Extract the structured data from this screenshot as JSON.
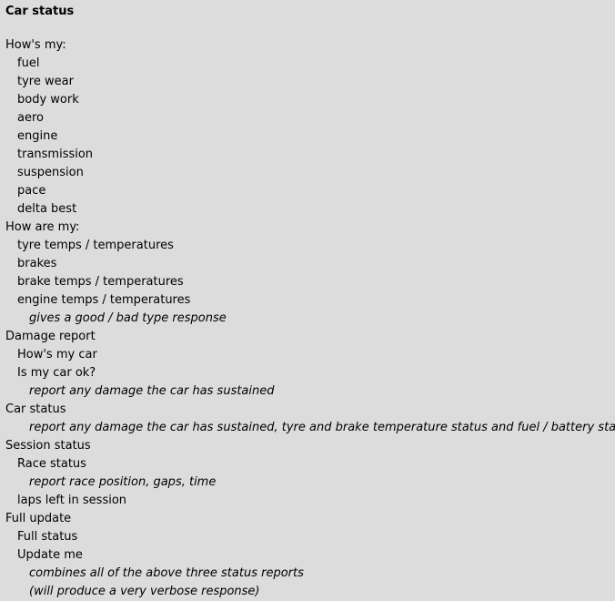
{
  "title": "Car status",
  "lines": [
    {
      "level": 0,
      "kind": "heading",
      "text": "How's my:"
    },
    {
      "level": 1,
      "kind": "phrase",
      "text": "fuel"
    },
    {
      "level": 1,
      "kind": "phrase",
      "text": "tyre wear"
    },
    {
      "level": 1,
      "kind": "phrase",
      "text": "body work"
    },
    {
      "level": 1,
      "kind": "phrase",
      "text": "aero"
    },
    {
      "level": 1,
      "kind": "phrase",
      "text": "engine"
    },
    {
      "level": 1,
      "kind": "phrase",
      "text": "transmission"
    },
    {
      "level": 1,
      "kind": "phrase",
      "text": "suspension"
    },
    {
      "level": 1,
      "kind": "phrase",
      "text": "pace"
    },
    {
      "level": 1,
      "kind": "phrase",
      "text": "delta best"
    },
    {
      "level": 0,
      "kind": "heading",
      "text": "How are my:"
    },
    {
      "level": 1,
      "kind": "phrase",
      "text": "tyre temps / temperatures"
    },
    {
      "level": 1,
      "kind": "phrase",
      "text": "brakes"
    },
    {
      "level": 1,
      "kind": "phrase",
      "text": "brake temps / temperatures"
    },
    {
      "level": 1,
      "kind": "phrase",
      "text": "engine temps / temperatures"
    },
    {
      "level": 2,
      "kind": "description",
      "text": "gives a good / bad type response"
    },
    {
      "level": 0,
      "kind": "heading",
      "text": "Damage report"
    },
    {
      "level": 1,
      "kind": "phrase",
      "text": "How's my car"
    },
    {
      "level": 1,
      "kind": "phrase",
      "text": "Is my car ok?"
    },
    {
      "level": 2,
      "kind": "description",
      "text": "report any damage the car has sustained"
    },
    {
      "level": 0,
      "kind": "heading",
      "text": "Car status"
    },
    {
      "level": 2,
      "kind": "description",
      "text": "report any damage the car has sustained, tyre and brake temperature status and fuel / battery status"
    },
    {
      "level": 0,
      "kind": "heading",
      "text": "Session status"
    },
    {
      "level": 1,
      "kind": "phrase",
      "text": "Race status"
    },
    {
      "level": 2,
      "kind": "description",
      "text": "report race position, gaps, time"
    },
    {
      "level": 1,
      "kind": "phrase",
      "text": "laps left in session"
    },
    {
      "level": 0,
      "kind": "heading",
      "text": "Full update"
    },
    {
      "level": 1,
      "kind": "phrase",
      "text": "Full status"
    },
    {
      "level": 1,
      "kind": "phrase",
      "text": "Update me"
    },
    {
      "level": 2,
      "kind": "description",
      "text": "combines all of the above three status reports"
    },
    {
      "level": 2,
      "kind": "description",
      "text": "(will produce a very verbose response)"
    }
  ]
}
